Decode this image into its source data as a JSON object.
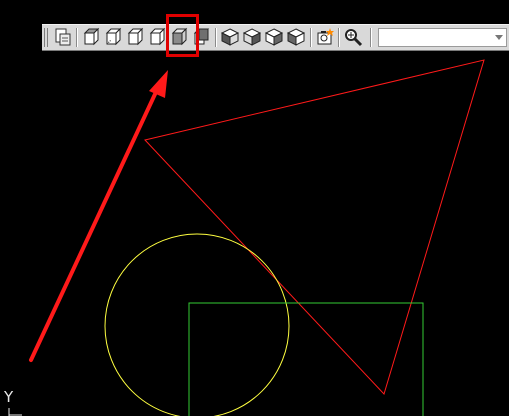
{
  "toolbar": {
    "buttons": [
      {
        "name": "named-views-button",
        "icon": "named-views-icon"
      },
      {
        "name": "top-view-button",
        "icon": "top-view-icon"
      },
      {
        "name": "bottom-view-button",
        "icon": "bottom-view-icon"
      },
      {
        "name": "left-view-button",
        "icon": "left-view-icon"
      },
      {
        "name": "right-view-button",
        "icon": "right-view-icon"
      },
      {
        "name": "front-view-button",
        "icon": "front-view-icon",
        "highlighted": true
      },
      {
        "name": "back-view-button",
        "icon": "back-view-icon"
      },
      {
        "name": "sw-isometric-button",
        "icon": "sw-isometric-icon"
      },
      {
        "name": "se-isometric-button",
        "icon": "se-isometric-icon"
      },
      {
        "name": "ne-isometric-button",
        "icon": "ne-isometric-icon"
      },
      {
        "name": "nw-isometric-button",
        "icon": "nw-isometric-icon"
      },
      {
        "name": "camera-button",
        "icon": "camera-icon"
      },
      {
        "name": "zoom-realtime-button",
        "icon": "zoom-icon"
      }
    ],
    "view_dropdown_value": ""
  },
  "ucs": {
    "axis_label": "Y"
  },
  "annotation": {
    "highlight_color": "#e00000",
    "arrow_color": "#ff1a1a"
  },
  "drawing_colors": {
    "background": "#000000",
    "triangle": "#ff1a1a",
    "circle": "#ffff40",
    "rectangle": "#33cc33"
  }
}
